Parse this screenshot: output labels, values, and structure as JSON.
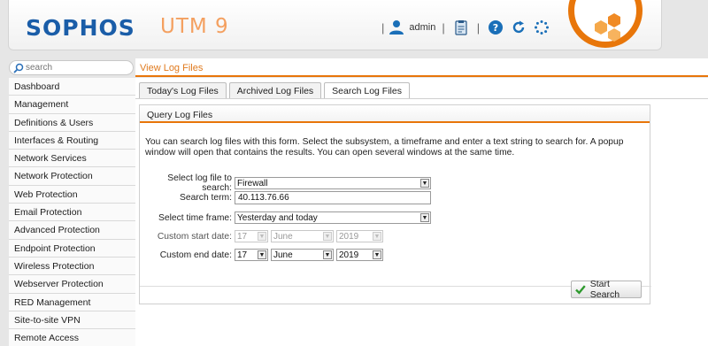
{
  "header": {
    "brand": "SOPHOS",
    "product": "UTM 9",
    "username": "admin",
    "separator": "|",
    "colors": {
      "brand": "#1a5da8",
      "product": "#f4a060",
      "accent": "#e8760a"
    }
  },
  "search": {
    "placeholder": "search"
  },
  "breadcrumb": "View Log Files",
  "sidebar": {
    "items": [
      {
        "label": "Dashboard"
      },
      {
        "label": "Management"
      },
      {
        "label": "Definitions & Users"
      },
      {
        "label": "Interfaces & Routing"
      },
      {
        "label": "Network Services"
      },
      {
        "label": "Network Protection"
      },
      {
        "label": "Web Protection"
      },
      {
        "label": "Email Protection"
      },
      {
        "label": "Advanced Protection"
      },
      {
        "label": "Endpoint Protection"
      },
      {
        "label": "Wireless Protection"
      },
      {
        "label": "Webserver Protection"
      },
      {
        "label": "RED Management"
      },
      {
        "label": "Site-to-site VPN"
      },
      {
        "label": "Remote Access"
      }
    ]
  },
  "tabs": [
    {
      "label": "Today's Log Files",
      "active": false
    },
    {
      "label": "Archived Log Files",
      "active": false
    },
    {
      "label": "Search Log Files",
      "active": true
    }
  ],
  "panel": {
    "title": "Query Log Files",
    "intro": "You can search log files with this form. Select the subsystem, a timeframe and enter a text string to search for. A popup window will open that contains the results. You can open several windows at the same time."
  },
  "form": {
    "log_file_label": "Select log file to search:",
    "log_file_value": "Firewall",
    "search_term_label": "Search term:",
    "search_term_value": "40.113.76.66",
    "time_frame_label": "Select time frame:",
    "time_frame_value": "Yesterday and today",
    "start_date_label": "Custom start date:",
    "start_day": "17",
    "start_month": "June",
    "start_year": "2019",
    "end_date_label": "Custom end date:",
    "end_day": "17",
    "end_month": "June",
    "end_year": "2019"
  },
  "start_button": "Start Search",
  "icons": [
    "user-icon",
    "clipboard-icon",
    "help-icon",
    "reload-icon",
    "spinner-icon",
    "search-icon",
    "check-icon",
    "dropdown-arrow-icon"
  ]
}
